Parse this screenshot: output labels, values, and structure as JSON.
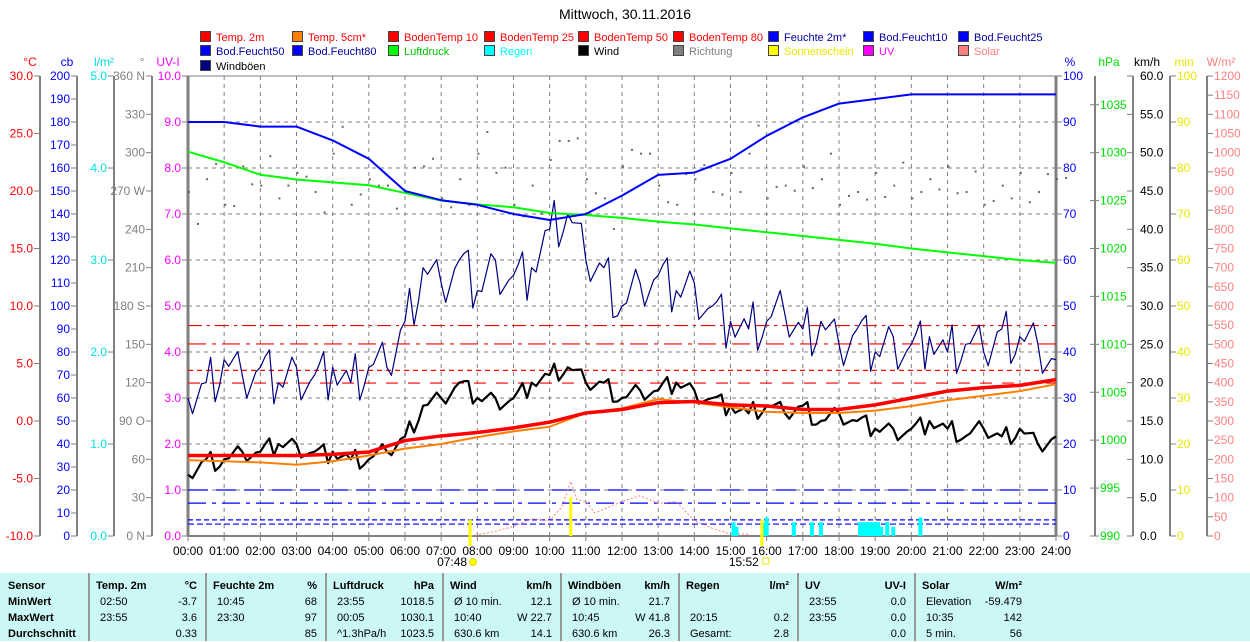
{
  "title": "Mittwoch, 30.11.2016",
  "legend": [
    {
      "label": "Temp. 2m",
      "color": "#ff0000"
    },
    {
      "label": "Temp. 5cm*",
      "color": "#ff8000"
    },
    {
      "label": "BodenTemp 10",
      "color": "#ff0000"
    },
    {
      "label": "BodenTemp 25",
      "color": "#ff0000"
    },
    {
      "label": "BodenTemp 50",
      "color": "#ff0000"
    },
    {
      "label": "BodenTemp 80",
      "color": "#ff0000"
    },
    {
      "label": "Feuchte 2m*",
      "color": "#0000ff"
    },
    {
      "label": "Bod.Feucht10",
      "color": "#0000ff"
    },
    {
      "label": "Bod.Feucht25",
      "color": "#0000ff"
    },
    {
      "label": "Bod.Feucht50",
      "color": "#0000ff"
    },
    {
      "label": "Bod.Feucht80",
      "color": "#0000ff"
    },
    {
      "label": "Luftdruck",
      "color": "#00ff00"
    },
    {
      "label": "Regen",
      "color": "#00ffff"
    },
    {
      "label": "Wind",
      "color": "#000000"
    },
    {
      "label": "Richtung",
      "color": "#808080"
    },
    {
      "label": "Sonnenschein",
      "color": "#ffff00"
    },
    {
      "label": "UV",
      "color": "#ff00ff"
    },
    {
      "label": "Solar",
      "color": "#ff8080"
    },
    {
      "label": "Windböen",
      "color": "#000080"
    }
  ],
  "chart_data": {
    "type": "line",
    "title": "Mittwoch, 30.11.2016",
    "x_ticks": [
      "00:00",
      "01:00",
      "02:00",
      "03:00",
      "04:00",
      "05:00",
      "06:00",
      "07:00",
      "08:00",
      "09:00",
      "10:00",
      "11:00",
      "12:00",
      "13:00",
      "14:00",
      "15:00",
      "16:00",
      "17:00",
      "18:00",
      "19:00",
      "20:00",
      "21:00",
      "22:00",
      "23:00",
      "24:00"
    ],
    "xlim_hours": [
      0,
      24
    ],
    "sunrise": "07:48",
    "sunset": "15:52",
    "axes_left": [
      {
        "title": "°C",
        "color": "#ff0000",
        "min": -10,
        "max": 30,
        "step": 5,
        "decimals": 1
      },
      {
        "title": "cb",
        "color": "#0000ff",
        "min": 0,
        "max": 200,
        "step": 10,
        "decimals": 0
      },
      {
        "title": "l/m²",
        "color": "#00e0e0",
        "min": 0,
        "max": 5,
        "step": 1,
        "decimals": 1
      },
      {
        "title": "°",
        "color": "#808080",
        "min": 0,
        "max": 360,
        "step": 30,
        "decimals": 0,
        "labels": [
          "0 N",
          "30",
          "60",
          "90 O",
          "120",
          "150",
          "180 S",
          "210",
          "240",
          "270 W",
          "300",
          "330",
          "360 N"
        ]
      },
      {
        "title": "UV-I",
        "color": "#ff00ff",
        "min": 0,
        "max": 10,
        "step": 1,
        "decimals": 1
      }
    ],
    "axes_right": [
      {
        "title": "%",
        "color": "#0000ff",
        "min": 0,
        "max": 100,
        "step": 10,
        "decimals": 0
      },
      {
        "title": "hPa",
        "color": "#00e000",
        "min": 990,
        "max": 1038,
        "step": 5,
        "decimals": 0,
        "first": 990
      },
      {
        "title": "km/h",
        "color": "#000000",
        "min": 0,
        "max": 60,
        "step": 5,
        "decimals": 1
      },
      {
        "title": "min",
        "color": "#e8e800",
        "min": 0,
        "max": 100,
        "step": 10,
        "decimals": 0
      },
      {
        "title": "W/m²",
        "color": "#ff8080",
        "min": 0,
        "max": 1200,
        "step": 50,
        "decimals": 0
      }
    ],
    "series_hourly": {
      "Temp. 2m": [
        -3.0,
        -3.0,
        -3.0,
        -3.0,
        -2.9,
        -2.7,
        -1.7,
        -1.3,
        -1.0,
        -0.6,
        -0.1,
        0.7,
        1.0,
        1.6,
        1.7,
        1.4,
        1.3,
        1.0,
        1.0,
        1.4,
        2.0,
        2.6,
        2.9,
        3.1,
        3.6
      ],
      "Temp. 5cm*": [
        -3.4,
        -3.5,
        -3.6,
        -3.8,
        -3.5,
        -3.0,
        -2.4,
        -2.0,
        -1.4,
        -0.9,
        -0.5,
        0.7,
        1.1,
        1.9,
        1.6,
        1.2,
        0.8,
        0.7,
        0.7,
        0.9,
        1.3,
        1.8,
        2.2,
        2.6,
        3.2
      ],
      "Feuchte 2m*": [
        90,
        90,
        89,
        89,
        86,
        82,
        75,
        73,
        72,
        70,
        68.7,
        70,
        74,
        78.5,
        79,
        82,
        87,
        91,
        94,
        95,
        96,
        96,
        96,
        96,
        96
      ],
      "Luftdruck": [
        1030.1,
        1029,
        1027.7,
        1027.2,
        1026.9,
        1026.6,
        1025.8,
        1025,
        1024.6,
        1024.3,
        1023.7,
        1023.5,
        1023.2,
        1022.8,
        1022.5,
        1022.1,
        1021.7,
        1021.3,
        1020.9,
        1020.5,
        1020,
        1019.6,
        1019.2,
        1018.8,
        1018.5
      ]
    },
    "soil_constant": {
      "BodenTemp 10": 3.3,
      "BodenTemp 25": 4.4,
      "BodenTemp 50": 6.7,
      "BodenTemp 80": 8.3,
      "Bod.Feucht10": 20,
      "Bod.Feucht25": 14.3,
      "Bod.Feucht50": 7,
      "Bod.Feucht80": 5.2
    },
    "series_halfhourly": {
      "Wind": [
        8,
        10,
        10,
        11,
        11,
        12,
        12,
        11,
        11,
        10,
        10,
        11,
        13,
        17,
        18,
        20,
        18,
        18,
        18,
        20,
        21,
        22,
        20,
        20,
        18,
        19,
        19,
        20,
        19,
        18,
        17,
        16,
        17,
        16,
        17,
        15,
        16,
        15,
        14,
        14,
        14,
        15,
        14,
        13,
        14,
        13,
        14,
        12,
        13
      ],
      "Windböen": [
        18,
        20,
        23,
        21,
        22,
        20,
        22,
        21,
        22,
        20,
        22,
        22,
        28,
        35,
        33,
        36,
        32,
        36,
        34,
        35,
        40,
        42,
        36,
        35,
        30,
        33,
        34,
        32,
        33,
        30,
        28,
        27,
        28,
        29,
        27,
        28,
        25,
        27,
        24,
        26,
        25,
        26,
        24,
        25,
        24,
        27,
        26,
        25,
        23
      ],
      "Richtung": [
        270,
        280,
        260,
        290,
        275,
        265,
        285,
        270,
        300,
        260,
        280,
        275,
        270,
        290,
        265,
        280,
        300,
        285,
        260,
        275,
        295,
        310,
        280,
        265,
        290,
        300,
        275,
        260,
        280,
        270,
        285,
        300,
        265,
        275,
        290,
        280,
        260,
        270,
        285,
        275,
        265,
        280,
        290,
        270,
        260,
        275,
        285,
        270,
        280
      ]
    },
    "rain": [
      [
        "15:05",
        0.15
      ],
      [
        "15:10",
        0.1
      ],
      [
        "15:55",
        0.15
      ],
      [
        "16:00",
        0.2
      ],
      [
        "16:45",
        0.15
      ],
      [
        "17:15",
        0.15
      ],
      [
        "17:30",
        0.15
      ],
      [
        "18:35",
        0.15
      ],
      [
        "18:40",
        0.15
      ],
      [
        "18:45",
        0.15
      ],
      [
        "18:50",
        0.15
      ],
      [
        "18:55",
        0.15
      ],
      [
        "19:00",
        0.15
      ],
      [
        "19:05",
        0.15
      ],
      [
        "19:10",
        0.1
      ],
      [
        "19:20",
        0.15
      ],
      [
        "19:30",
        0.1
      ],
      [
        "20:15",
        0.2
      ]
    ],
    "solar": [
      [
        "07:50",
        0
      ],
      [
        "08:30",
        12
      ],
      [
        "09:00",
        25
      ],
      [
        "09:30",
        45
      ],
      [
        "10:00",
        40
      ],
      [
        "10:20",
        75
      ],
      [
        "10:35",
        142
      ],
      [
        "10:45",
        95
      ],
      [
        "11:00",
        90
      ],
      [
        "11:15",
        60
      ],
      [
        "11:30",
        70
      ],
      [
        "12:00",
        90
      ],
      [
        "12:30",
        105
      ],
      [
        "13:00",
        85
      ],
      [
        "13:30",
        90
      ],
      [
        "14:00",
        40
      ],
      [
        "14:30",
        20
      ],
      [
        "15:00",
        5
      ],
      [
        "15:30",
        5
      ]
    ],
    "sunshine": [
      [
        "07:48",
        0.6
      ],
      [
        "10:35",
        1.4
      ],
      [
        "15:52",
        0.6
      ]
    ]
  },
  "table": {
    "row_labels": [
      "Sensor",
      "MinWert",
      "MaxWert",
      "Durchschnitt"
    ],
    "columns": [
      {
        "head": "Temp. 2m",
        "unit": "°C",
        "rows": [
          [
            "02:50",
            "-3.7"
          ],
          [
            "23:55",
            "3.6"
          ],
          [
            "",
            "0.33"
          ]
        ]
      },
      {
        "head": "Feuchte 2m",
        "unit": "%",
        "rows": [
          [
            "10:45",
            "68"
          ],
          [
            "23:30",
            "97"
          ],
          [
            "",
            "85"
          ]
        ]
      },
      {
        "head": "Luftdruck",
        "unit": "hPa",
        "rows": [
          [
            "23:55",
            "1018.5"
          ],
          [
            "00:05",
            "1030.1"
          ],
          [
            "^1.3hPa/h",
            "1023.5"
          ]
        ]
      },
      {
        "head": "Wind",
        "unit": "km/h",
        "rows": [
          [
            "Ø 10 min.",
            "12.1"
          ],
          [
            "10:40",
            "W 22.7"
          ],
          [
            "630.6 km",
            "14.1"
          ]
        ]
      },
      {
        "head": "Windböen",
        "unit": "km/h",
        "rows": [
          [
            "Ø 10 min.",
            "21.7"
          ],
          [
            "10:45",
            "W 41.8"
          ],
          [
            "630.6 km",
            "26.3"
          ]
        ]
      },
      {
        "head": "Regen",
        "unit": "l/m²",
        "rows": [
          [
            "",
            ""
          ],
          [
            "20:15",
            "0.2"
          ],
          [
            "Gesamt:",
            "2.8"
          ]
        ]
      },
      {
        "head": "UV",
        "unit": "UV-I",
        "rows": [
          [
            "23:55",
            "0.0"
          ],
          [
            "23:55",
            "0.0"
          ],
          [
            "",
            "0.0"
          ]
        ]
      },
      {
        "head": "Solar",
        "unit": "W/m²",
        "rows": [
          [
            "Elevation",
            "-59.479"
          ],
          [
            "10:35",
            "142"
          ],
          [
            "5 min.",
            "56"
          ]
        ]
      }
    ]
  }
}
